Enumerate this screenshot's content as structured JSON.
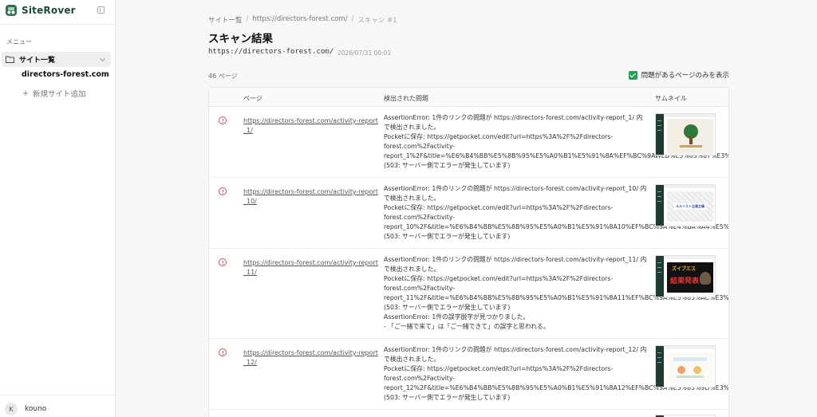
{
  "app": {
    "name": "SiteRover"
  },
  "sidebar": {
    "menu_label": "メニュー",
    "site_list_label": "サイト一覧",
    "site_entry": "directors-forest.com",
    "add_site_label": "新規サイト追加",
    "user": {
      "initial": "K",
      "name": "kouno"
    }
  },
  "breadcrumb": {
    "items": [
      "サイト一覧",
      "https://directors-forest.com/",
      "スキャン #1"
    ]
  },
  "page": {
    "title": "スキャン結果",
    "url": "https://directors-forest.com/",
    "datetime": "2026/07/31 00:01",
    "count": "46 ページ",
    "filter_label": "問題があるページのみを表示",
    "filter_checked": true
  },
  "table": {
    "headers": {
      "page": "ページ",
      "issues": "検出された問題",
      "thumbnail": "サムネイル"
    },
    "rows": [
      {
        "page_url": "https://directors-forest.com/activity-report_1/",
        "issues": [
          "AssertionError: 1件のリンクの問題が https://directors-forest.com/activity-report_1/ 内",
          "で検出されました。",
          "Pocketに保存: https://getpocket.com/edit?url=https%3A%2F%2Fdirectors-",
          "forest.com%2Factivity-",
          "report_1%2F&title=%E6%B4%BB%E5%8B%95%E5%A0%B1%E5%91%8A%EF%BC%9AWEB%E3%83%87%E3%8",
          "(503: サーバー側でエラーが発生しています)"
        ]
      },
      {
        "page_url": "https://directors-forest.com/activity-report_10/",
        "issues": [
          "AssertionError: 1件のリンクの問題が https://directors-forest.com/activity-report_10/ 内",
          "で検出されました。",
          "Pocketに保存: https://getpocket.com/edit?url=https%3A%2F%2Fdirectors-",
          "forest.com%2Factivity-",
          "report_10%2F&title=%E6%B4%BB%E5%8B%95%E5%A0%B1%E5%91%8A10%EF%BC%9A%E4%BA%A4%E5%B5",
          "(503: サーバー側でエラーが発生しています)"
        ]
      },
      {
        "page_url": "https://directors-forest.com/activity-report_11/",
        "issues": [
          "AssertionError: 1件のリンクの問題が https://directors-forest.com/activity-report_11/ 内",
          "で検出されました。",
          "Pocketに保存: https://getpocket.com/edit?url=https%3A%2F%2Fdirectors-",
          "forest.com%2Factivity-",
          "report_11%2F&title=%E6%B4%BB%E5%8B%95%E5%A0%B1%E5%91%8A11%EF%BC%9A%E3%83%AC%E3%B",
          "(503: サーバー側でエラーが発生しています)",
          "AssertionError: 1件の誤字脱字が見つかりました。",
          "- 「ご一緒で来て」は「ご一緒できて」の誤字と思われる。"
        ]
      },
      {
        "page_url": "https://directors-forest.com/activity-report_12/",
        "issues": [
          "AssertionError: 1件のリンクの問題が https://directors-forest.com/activity-report_12/ 内",
          "で検出されました。",
          "Pocketに保存: https://getpocket.com/edit?url=https%3A%2F%2Fdirectors-",
          "forest.com%2Factivity-",
          "report_12%2F&title=%E6%B4%BB%E5%8B%95%E5%A0%B1%E5%91%8A12%EF%BC%9A%E3%83%9D%E3%8",
          "(503: サーバー側でエラーが発生しています)"
        ]
      }
    ]
  },
  "thumbnails": {
    "row2_caption": "ルルリスト企画主催",
    "row3_caption": "結果発表",
    "row3_label": "ズイブエス"
  },
  "colors": {
    "accent": "#2a9d5b",
    "error": "#d9534f",
    "brand": "#1c4a38"
  }
}
